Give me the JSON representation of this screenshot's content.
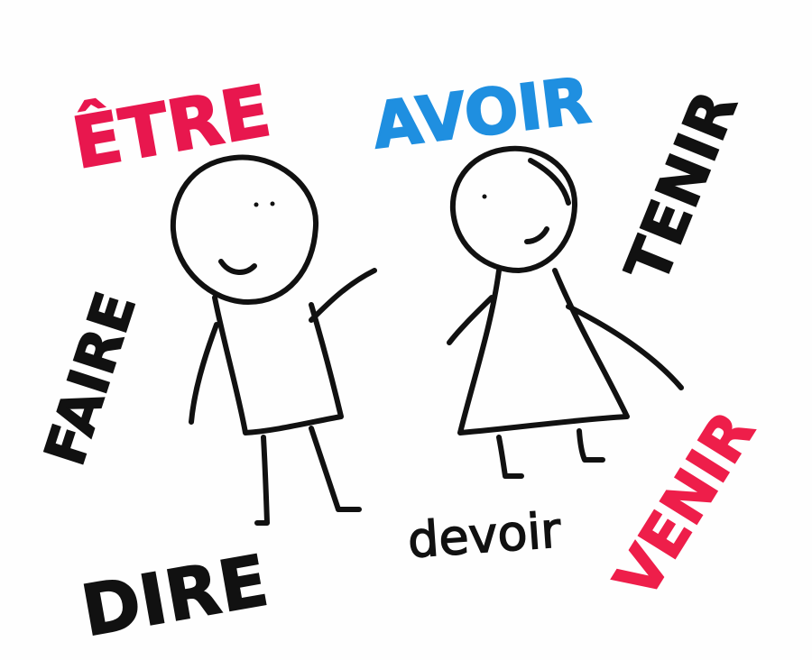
{
  "words": {
    "etre": {
      "text": "ÊTRE",
      "color": "#e8174e"
    },
    "avoir": {
      "text": "AVOIR",
      "color": "#1f8fe0"
    },
    "tenir": {
      "text": "TENIR",
      "color": "#111111"
    },
    "faire": {
      "text": "FAIRE",
      "color": "#111111"
    },
    "dire": {
      "text": "DIRE",
      "color": "#111111"
    },
    "devoir": {
      "text": "devoir",
      "color": "#111111"
    },
    "venir": {
      "text": "VENIR",
      "color": "#ee1e4a"
    }
  },
  "figures": {
    "stroke_color": "#111111",
    "left_figure": "stick-figure-man",
    "right_figure": "stick-figure-woman"
  }
}
